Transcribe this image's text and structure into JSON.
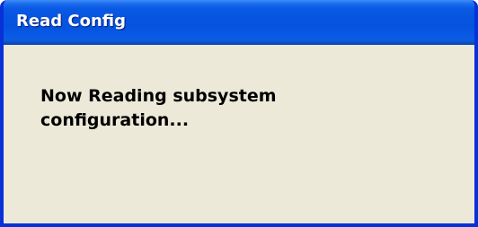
{
  "window": {
    "title": "Read Config"
  },
  "content": {
    "message": "Now Reading subsystem\nconfiguration..."
  },
  "colors": {
    "titlebar": "#0654e0",
    "frame": "#0831d9",
    "client_background": "#ece9d8",
    "title_text": "#ffffff",
    "message_text": "#000000"
  }
}
